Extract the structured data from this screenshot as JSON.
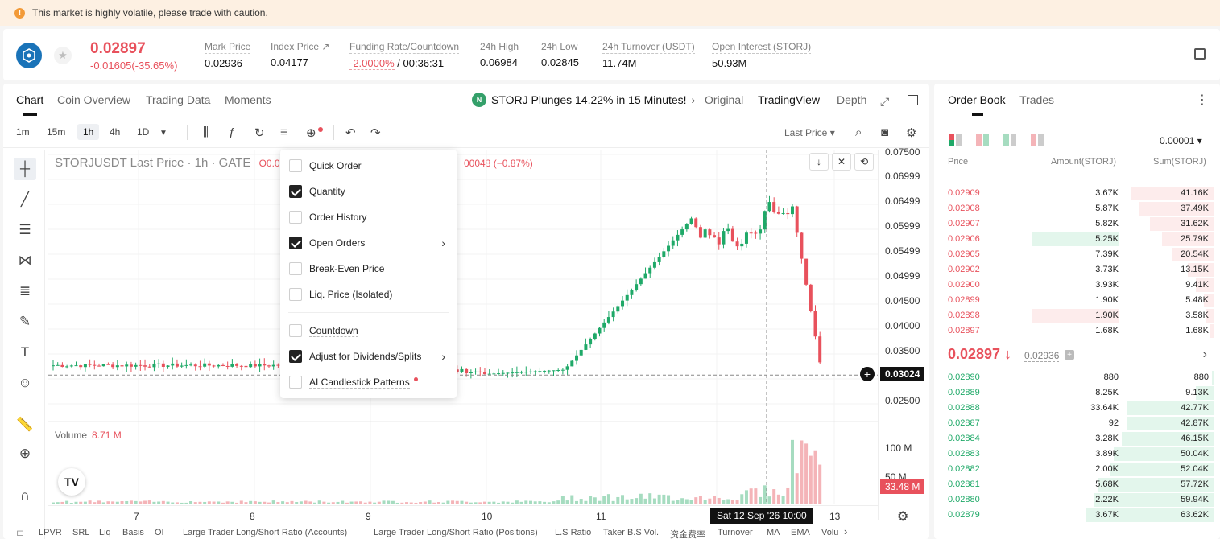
{
  "banner": {
    "text": "This market is highly volatile, please trade with caution."
  },
  "ticker": {
    "last_price": "0.02897",
    "change": "-0.01605(-35.65%)",
    "stats": [
      {
        "label": "Mark Price",
        "value": "0.02936"
      },
      {
        "label": "Index Price ↗",
        "value": "0.04177"
      },
      {
        "label": "Funding Rate/Countdown",
        "value_red": "-2.0000%",
        "value": " / 00:36:31"
      },
      {
        "label": "24h High",
        "value": "0.06984"
      },
      {
        "label": "24h Low",
        "value": "0.02845"
      },
      {
        "label": "24h Turnover (USDT)",
        "value": "11.74M"
      },
      {
        "label": "Open Interest (STORJ)",
        "value": "50.93M"
      }
    ]
  },
  "chart_tabs": [
    "Chart",
    "Coin Overview",
    "Trading Data",
    "Moments"
  ],
  "news": "STORJ Plunges 14.22% in 15 Minutes!",
  "view_tabs": [
    "Original",
    "TradingView",
    "Depth"
  ],
  "timeframes": [
    "1m",
    "15m",
    "1h",
    "4h",
    "1D"
  ],
  "last_price_select": "Last Price",
  "symbol": {
    "text": "STORJUSDT Last Price · 1h · GATE",
    "open": "O0.05",
    "change": "00048 (−0.87%)"
  },
  "volume": {
    "label": "Volume",
    "value": "8.71 M"
  },
  "menu": [
    {
      "label": "Quick Order",
      "checked": false,
      "arrow": false
    },
    {
      "label": "Quantity",
      "checked": true,
      "arrow": false
    },
    {
      "label": "Order History",
      "checked": false,
      "arrow": false
    },
    {
      "label": "Open Orders",
      "checked": true,
      "arrow": true
    },
    {
      "label": "Break-Even Price",
      "checked": false,
      "arrow": false
    },
    {
      "label": "Liq. Price (Isolated)",
      "checked": false,
      "arrow": false
    },
    {
      "label": "Countdown",
      "checked": false,
      "arrow": false
    },
    {
      "label": "Adjust for Dividends/Splits",
      "checked": true,
      "arrow": true
    },
    {
      "label": "AI Candlestick Patterns",
      "checked": false,
      "arrow": false
    }
  ],
  "y_axis": [
    "0.07500",
    "0.06999",
    "0.06499",
    "0.05999",
    "0.05499",
    "0.04999",
    "0.04500",
    "0.04000",
    "0.03500",
    "0.03024",
    "0.02500"
  ],
  "vol_axis": [
    "100 M",
    "50 M",
    "33.48 M"
  ],
  "x_axis": [
    "7",
    "8",
    "9",
    "10",
    "11",
    "13"
  ],
  "crosshair_time": "Sat 12 Sep '26   10:00",
  "indicators": [
    "LPVR",
    "SRL",
    "Liq",
    "Basis",
    "OI",
    "Large Trader Long/Short Ratio (Accounts)",
    "Large Trader Long/Short Ratio (Positions)",
    "L.S Ratio",
    "Taker B.S Vol.",
    "资金费率",
    "Turnover",
    "MA",
    "EMA",
    "Volu"
  ],
  "orderbook": {
    "tabs": [
      "Order Book",
      "Trades"
    ],
    "precision": "0.00001",
    "headers": [
      "Price",
      "Amount(STORJ)",
      "Sum(STORJ)"
    ],
    "asks": [
      {
        "price": "0.02909",
        "amount": "3.67K",
        "sum": "41.16K",
        "depth": 0.41
      },
      {
        "price": "0.02908",
        "amount": "5.87K",
        "sum": "37.49K",
        "depth": 0.37
      },
      {
        "price": "0.02907",
        "amount": "5.82K",
        "sum": "31.62K",
        "depth": 0.32
      },
      {
        "price": "0.02906",
        "amount": "5.25K",
        "sum": "25.79K",
        "depth": 0.26
      },
      {
        "price": "0.02905",
        "amount": "7.39K",
        "sum": "20.54K",
        "depth": 0.21
      },
      {
        "price": "0.02902",
        "amount": "3.73K",
        "sum": "13.15K",
        "depth": 0.13
      },
      {
        "price": "0.02900",
        "amount": "3.93K",
        "sum": "9.41K",
        "depth": 0.09
      },
      {
        "price": "0.02899",
        "amount": "1.90K",
        "sum": "5.48K",
        "depth": 0.05
      },
      {
        "price": "0.02898",
        "amount": "1.90K",
        "sum": "3.58K",
        "depth": 0.04
      },
      {
        "price": "0.02897",
        "amount": "1.68K",
        "sum": "1.68K",
        "depth": 0.02
      }
    ],
    "mid_price": "0.02897 ↓",
    "mark_price": "0.02936",
    "bids": [
      {
        "price": "0.02890",
        "amount": "880",
        "sum": "880",
        "depth": 0.01
      },
      {
        "price": "0.02889",
        "amount": "8.25K",
        "sum": "9.13K",
        "depth": 0.09
      },
      {
        "price": "0.02888",
        "amount": "33.64K",
        "sum": "42.77K",
        "depth": 0.43
      },
      {
        "price": "0.02887",
        "amount": "92",
        "sum": "42.87K",
        "depth": 0.43
      },
      {
        "price": "0.02884",
        "amount": "3.28K",
        "sum": "46.15K",
        "depth": 0.46
      },
      {
        "price": "0.02883",
        "amount": "3.89K",
        "sum": "50.04K",
        "depth": 0.5
      },
      {
        "price": "0.02882",
        "amount": "2.00K",
        "sum": "52.04K",
        "depth": 0.52
      },
      {
        "price": "0.02881",
        "amount": "5.68K",
        "sum": "57.72K",
        "depth": 0.58
      },
      {
        "price": "0.02880",
        "amount": "2.22K",
        "sum": "59.94K",
        "depth": 0.6
      },
      {
        "price": "0.02879",
        "amount": "3.67K",
        "sum": "63.62K",
        "depth": 0.64
      }
    ]
  },
  "colors": {
    "up": "#1fa968",
    "down": "#e8515c"
  }
}
